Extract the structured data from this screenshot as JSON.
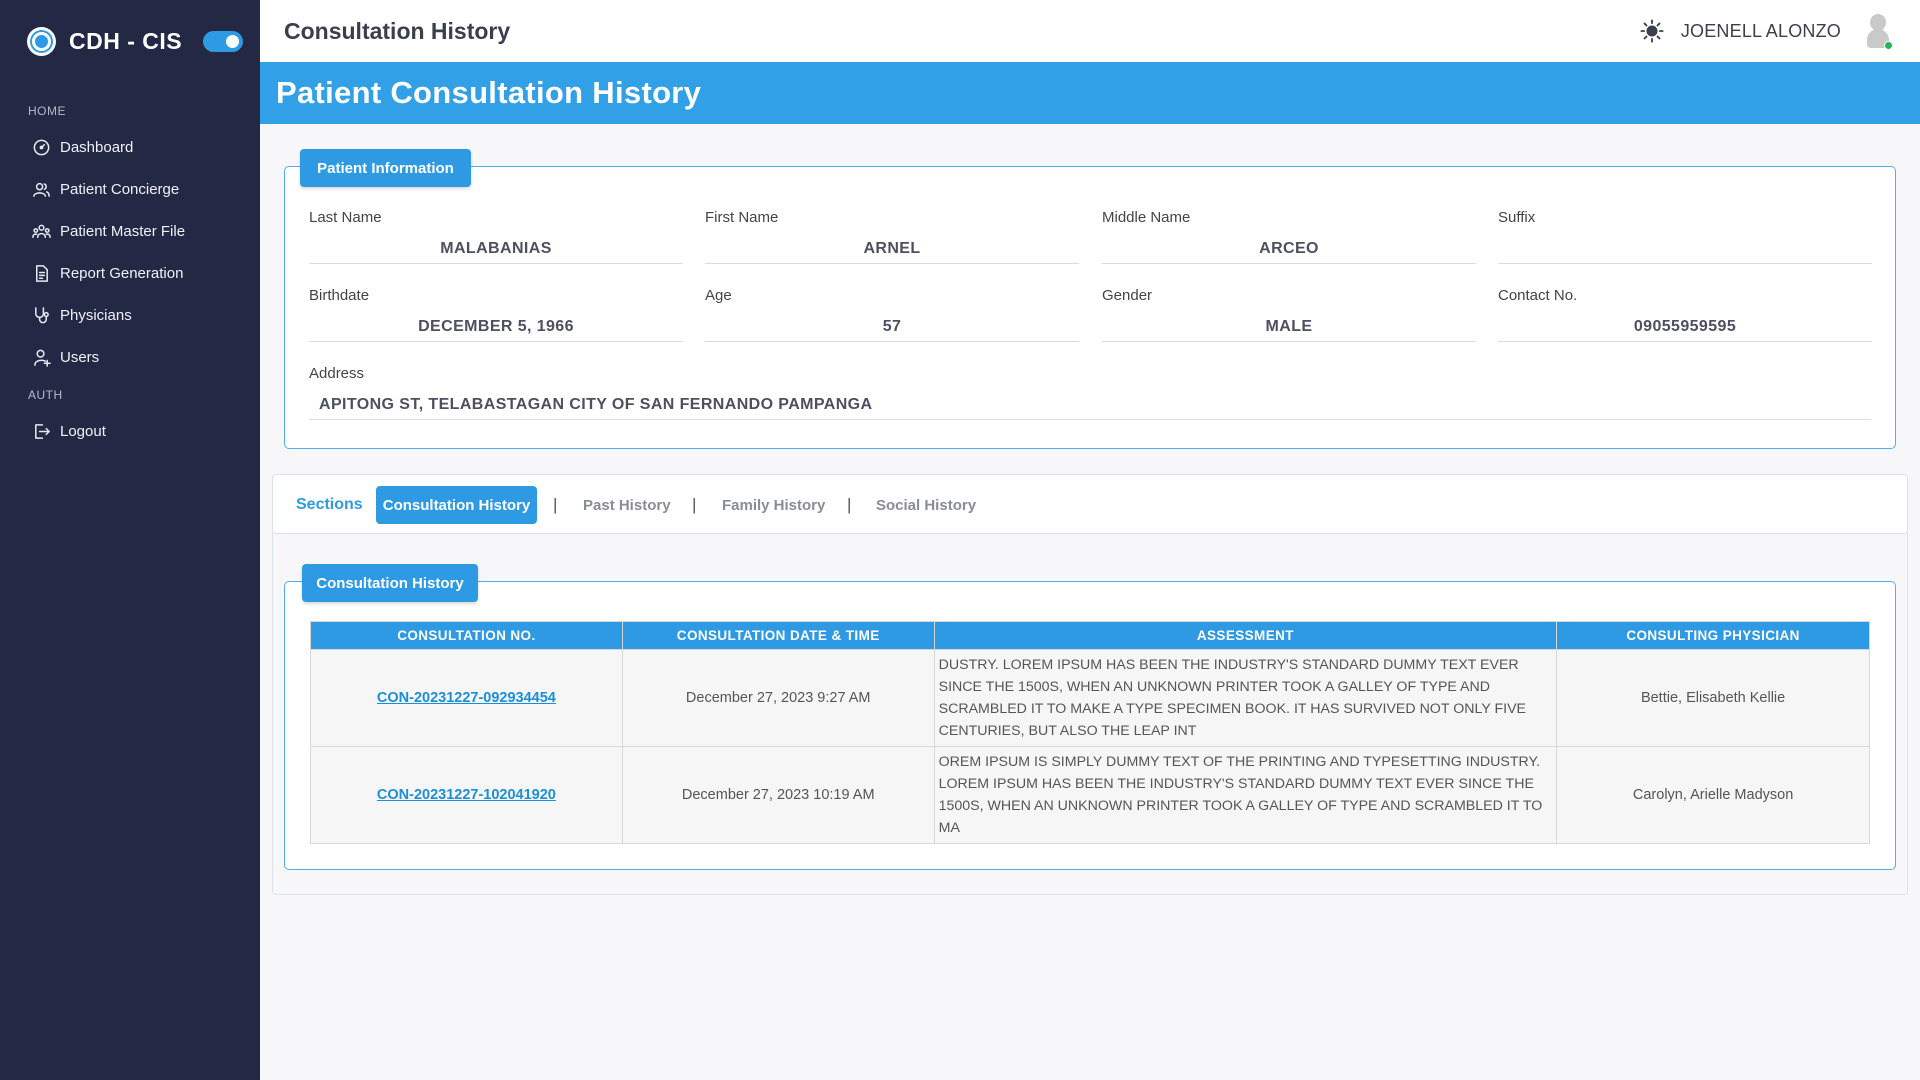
{
  "app": {
    "brand": "CDH - CIS",
    "page_title": "Consultation History"
  },
  "sidebar": {
    "home_section": "HOME",
    "home_items": [
      {
        "label": "Dashboard",
        "icon": "dashboard-icon"
      },
      {
        "label": "Patient Concierge",
        "icon": "users-icon"
      },
      {
        "label": "Patient Master File",
        "icon": "user-group-icon"
      },
      {
        "label": "Report Generation",
        "icon": "document-icon"
      },
      {
        "label": "Physicians",
        "icon": "stethoscope-icon"
      },
      {
        "label": "Users",
        "icon": "user-add-icon"
      }
    ],
    "auth_section": "AUTH",
    "auth_items": [
      {
        "label": "Logout",
        "icon": "logout-icon"
      }
    ]
  },
  "header": {
    "user_name": "JOENELL ALONZO"
  },
  "banner": {
    "title": "Patient Consultation History"
  },
  "patient_info": {
    "legend": "Patient Information",
    "last_name": {
      "label": "Last Name",
      "value": "MALABANIAS"
    },
    "first_name": {
      "label": "First Name",
      "value": "ARNEL"
    },
    "middle_name": {
      "label": "Middle Name",
      "value": "ARCEO"
    },
    "suffix": {
      "label": "Suffix",
      "value": ""
    },
    "birthdate": {
      "label": "Birthdate",
      "value": "DECEMBER 5, 1966"
    },
    "age": {
      "label": "Age",
      "value": "57"
    },
    "gender": {
      "label": "Gender",
      "value": "MALE"
    },
    "contact": {
      "label": "Contact No.",
      "value": "09055959595"
    },
    "address": {
      "label": "Address",
      "value": "APITONG ST, TELABASTAGAN CITY OF SAN FERNANDO PAMPANGA"
    }
  },
  "tabs": {
    "sections": "Sections",
    "items": [
      "Consultation History",
      "Past History",
      "Family History",
      "Social History"
    ],
    "separator": "|"
  },
  "history": {
    "legend": "Consultation History",
    "columns": [
      "CONSULTATION NO.",
      "CONSULTATION DATE & TIME",
      "ASSESSMENT",
      "CONSULTING PHYSICIAN"
    ],
    "rows": [
      {
        "no": "CON-20231227-092934454",
        "datetime": "December 27, 2023 9:27 AM",
        "assessment": "DUSTRY. LOREM IPSUM HAS BEEN THE INDUSTRY'S STANDARD DUMMY TEXT EVER SINCE THE 1500S, WHEN AN UNKNOWN PRINTER TOOK A GALLEY OF TYPE AND SCRAMBLED IT TO MAKE A TYPE SPECIMEN BOOK. IT HAS SURVIVED NOT ONLY FIVE CENTURIES, BUT ALSO THE LEAP INT",
        "physician": "Bettie, Elisabeth Kellie"
      },
      {
        "no": "CON-20231227-102041920",
        "datetime": "December 27, 2023 10:19 AM",
        "assessment": "OREM IPSUM IS SIMPLY DUMMY TEXT OF THE PRINTING AND TYPESETTING INDUSTRY. LOREM IPSUM HAS BEEN THE INDUSTRY'S STANDARD DUMMY TEXT EVER SINCE THE 1500S, WHEN AN UNKNOWN PRINTER TOOK A GALLEY OF TYPE AND SCRAMBLED IT TO MA",
        "physician": "Carolyn, Arielle Madyson"
      }
    ]
  },
  "colors": {
    "accent": "#2f9ae4",
    "sidebar_bg": "#232845",
    "online_status": "#22b55a"
  }
}
